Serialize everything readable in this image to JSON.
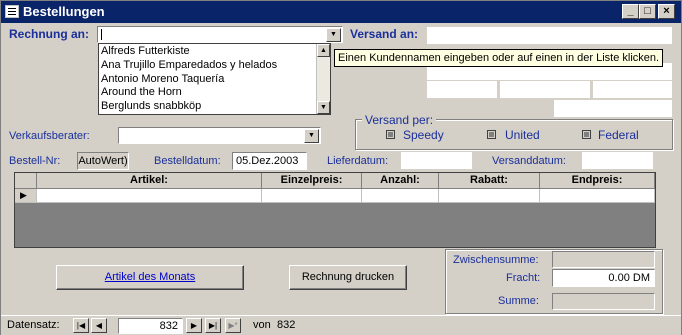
{
  "window": {
    "title": "Bestellungen",
    "minimize_label": "_",
    "maximize_label": "□",
    "close_label": "×"
  },
  "billing": {
    "label": "Rechnung an:",
    "value": "",
    "dropdown_items": [
      "Alfreds Futterkiste",
      "Ana Trujillo Emparedados y helados",
      "Antonio Moreno Taquería",
      "Around the Horn",
      "Berglunds snabbköp"
    ]
  },
  "tooltip": "Einen Kundennamen eingeben oder auf einen in der Liste klicken.",
  "shipping": {
    "label": "Versand an:"
  },
  "shipvia": {
    "label": "Versand per:",
    "options": [
      "Speedy",
      "United",
      "Federal"
    ]
  },
  "salesperson": {
    "label": "Verkaufsberater:",
    "value": ""
  },
  "order": {
    "id_label": "Bestell-Nr:",
    "id_value": "AutoWert)",
    "date_label": "Bestelldatum:",
    "date_value": "05.Dez.2003",
    "delivery_label": "Lieferdatum:",
    "delivery_value": "",
    "ship_date_label": "Versanddatum:",
    "ship_date_value": ""
  },
  "details_grid": {
    "columns": [
      "Artikel:",
      "Einzelpreis:",
      "Anzahl:",
      "Rabatt:",
      "Endpreis:"
    ],
    "row_selector": "▶"
  },
  "buttons": {
    "product_of_month": "Artikel des Monats",
    "print_invoice": "Rechnung drucken"
  },
  "totals": {
    "subtotal_label": "Zwischensumme:",
    "subtotal_value": "",
    "freight_label": "Fracht:",
    "freight_value": "0.00 DM",
    "total_label": "Summe:",
    "total_value": ""
  },
  "navigation": {
    "label": "Datensatz:",
    "current": "832",
    "of_label": "von",
    "total": "832",
    "first": "|◀",
    "prev": "◀",
    "next": "▶",
    "last": "▶|",
    "new": "▶*"
  }
}
